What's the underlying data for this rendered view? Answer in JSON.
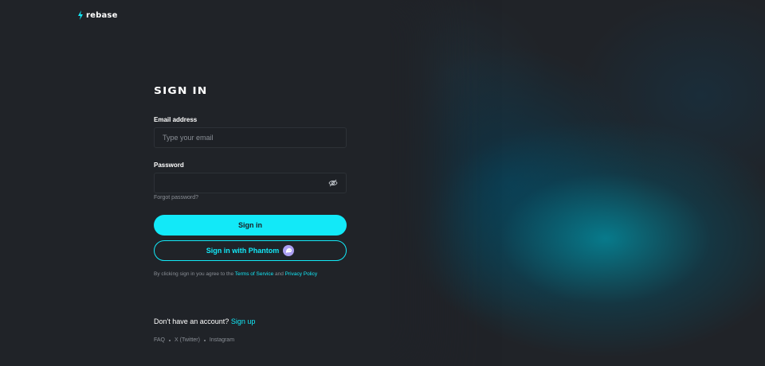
{
  "brand": {
    "name": "rebase",
    "accent": "#12e9f8"
  },
  "form": {
    "title": "SIGN IN",
    "email": {
      "label": "Email address",
      "placeholder": "Type your email",
      "value": ""
    },
    "password": {
      "label": "Password",
      "placeholder": "",
      "value": "",
      "toggle_icon": "eye-off-icon"
    },
    "forgot_label": "Forgot password?",
    "sign_in_label": "Sign in",
    "phantom_label": "Sign in with Phantom",
    "phantom_icon": "phantom-ghost-icon",
    "phantom_color": "#ab9ff2"
  },
  "legal": {
    "prefix": "By clicking sign in you agree to the ",
    "terms": "Terms of Service",
    "middle": " and ",
    "privacy": "Privacy Policy"
  },
  "signup": {
    "prompt": "Don't have an account?",
    "link": "Sign up"
  },
  "footer": {
    "links": [
      "FAQ",
      "X (Twitter)",
      "Instagram"
    ]
  }
}
